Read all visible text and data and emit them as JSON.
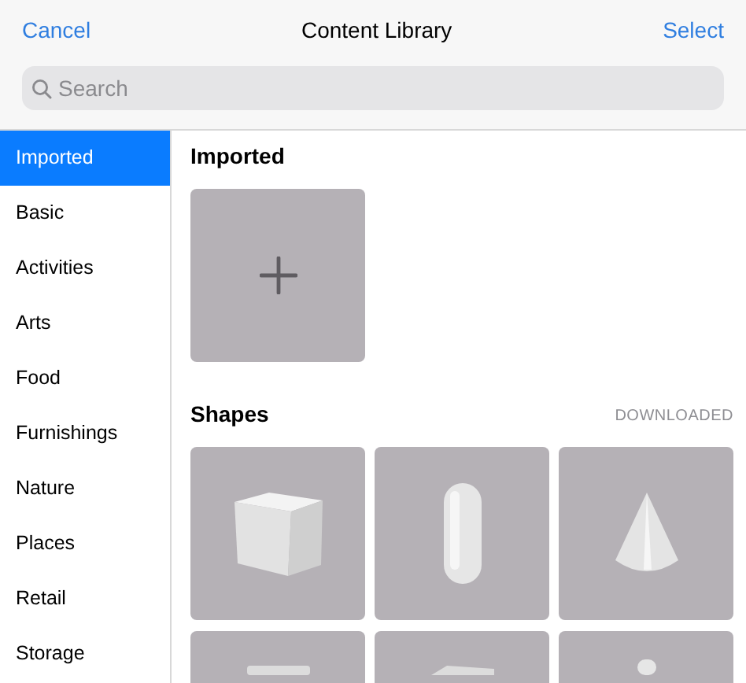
{
  "nav": {
    "cancel": "Cancel",
    "title": "Content Library",
    "select": "Select"
  },
  "search": {
    "placeholder": "Search"
  },
  "sidebar": {
    "items": [
      {
        "label": "Imported",
        "selected": true
      },
      {
        "label": "Basic",
        "selected": false
      },
      {
        "label": "Activities",
        "selected": false
      },
      {
        "label": "Arts",
        "selected": false
      },
      {
        "label": "Food",
        "selected": false
      },
      {
        "label": "Furnishings",
        "selected": false
      },
      {
        "label": "Nature",
        "selected": false
      },
      {
        "label": "Places",
        "selected": false
      },
      {
        "label": "Retail",
        "selected": false
      },
      {
        "label": "Storage",
        "selected": false
      }
    ]
  },
  "sections": [
    {
      "title": "Imported",
      "tiles": [
        {
          "kind": "add"
        }
      ]
    },
    {
      "title": "Shapes",
      "status": "DOWNLOADED",
      "tiles": [
        {
          "kind": "cube"
        },
        {
          "kind": "capsule"
        },
        {
          "kind": "cone"
        },
        {
          "kind": "slab"
        },
        {
          "kind": "wedge"
        },
        {
          "kind": "knob"
        }
      ]
    }
  ]
}
